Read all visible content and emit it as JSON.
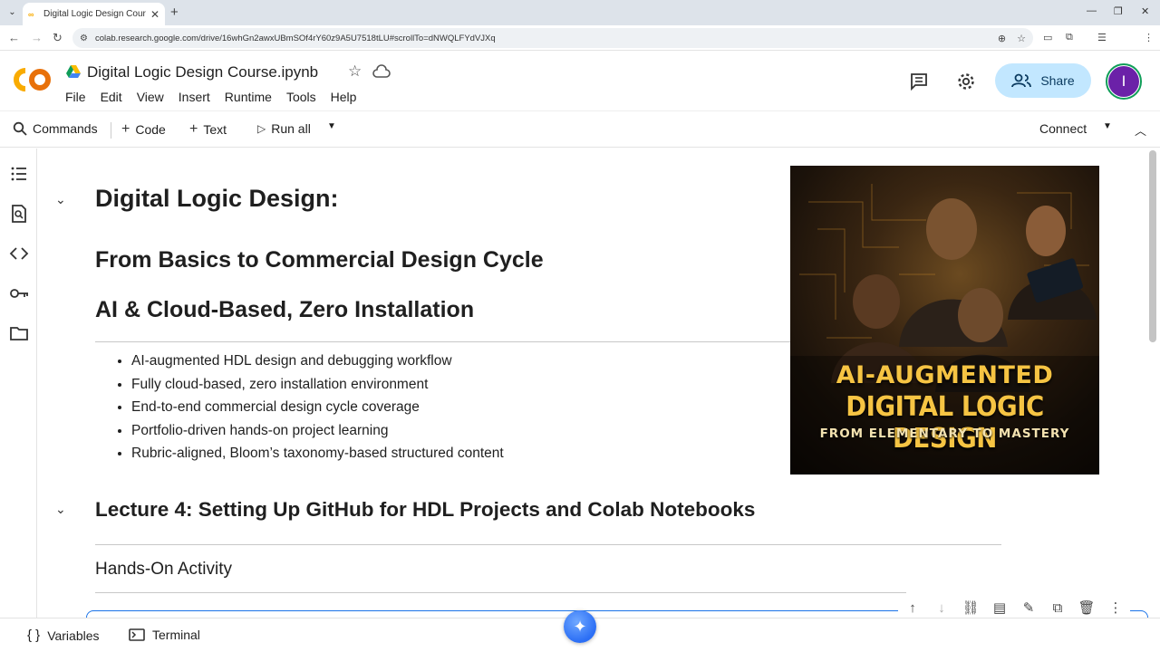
{
  "browser": {
    "tab_title": "Digital Logic Design Course.ipynb",
    "url": "colab.research.google.com/drive/16whGn2awxUBmSOf4rY60z9A5U7518tLU#scrollTo=dNWQLFYdVJXq",
    "profile_initial": "I"
  },
  "colab": {
    "logo_text": "CO",
    "notebook_title": "Digital Logic Design Course.ipynb",
    "menu": [
      "File",
      "Edit",
      "View",
      "Insert",
      "Runtime",
      "Tools",
      "Help"
    ],
    "share_label": "Share",
    "avatar_initial": "I"
  },
  "toolbar": {
    "commands": "Commands",
    "code": "Code",
    "text": "Text",
    "run_all": "Run all",
    "connect": "Connect"
  },
  "content": {
    "title": "Digital Logic Design:",
    "subtitle1": "From Basics to Commercial Design Cycle",
    "subtitle2": "AI & Cloud-Based, Zero Installation",
    "bullets": [
      "AI-augmented HDL design and debugging workflow",
      "Fully cloud-based, zero installation environment",
      "End-to-end commercial design cycle coverage",
      "Portfolio-driven hands-on project learning",
      "Rubric-aligned, Bloom’s taxonomy-based structured content"
    ],
    "lecture_heading": "Lecture 4: Setting Up GitHub for HDL Projects and Colab Notebooks",
    "hands_on": "Hands-On Activity"
  },
  "cover_image": {
    "line1": "AI-AUGMENTED",
    "line2": "DIGITAL LOGIC DESIGN",
    "line3": "FROM ELEMENTARY TO MASTERY"
  },
  "bottombar": {
    "variables": "Variables",
    "terminal": "Terminal"
  },
  "colors": {
    "accent": "#1a73e8",
    "share_bg": "#c2e7ff",
    "avatar": "#6b21a8",
    "cover_text": "#f6c443"
  }
}
